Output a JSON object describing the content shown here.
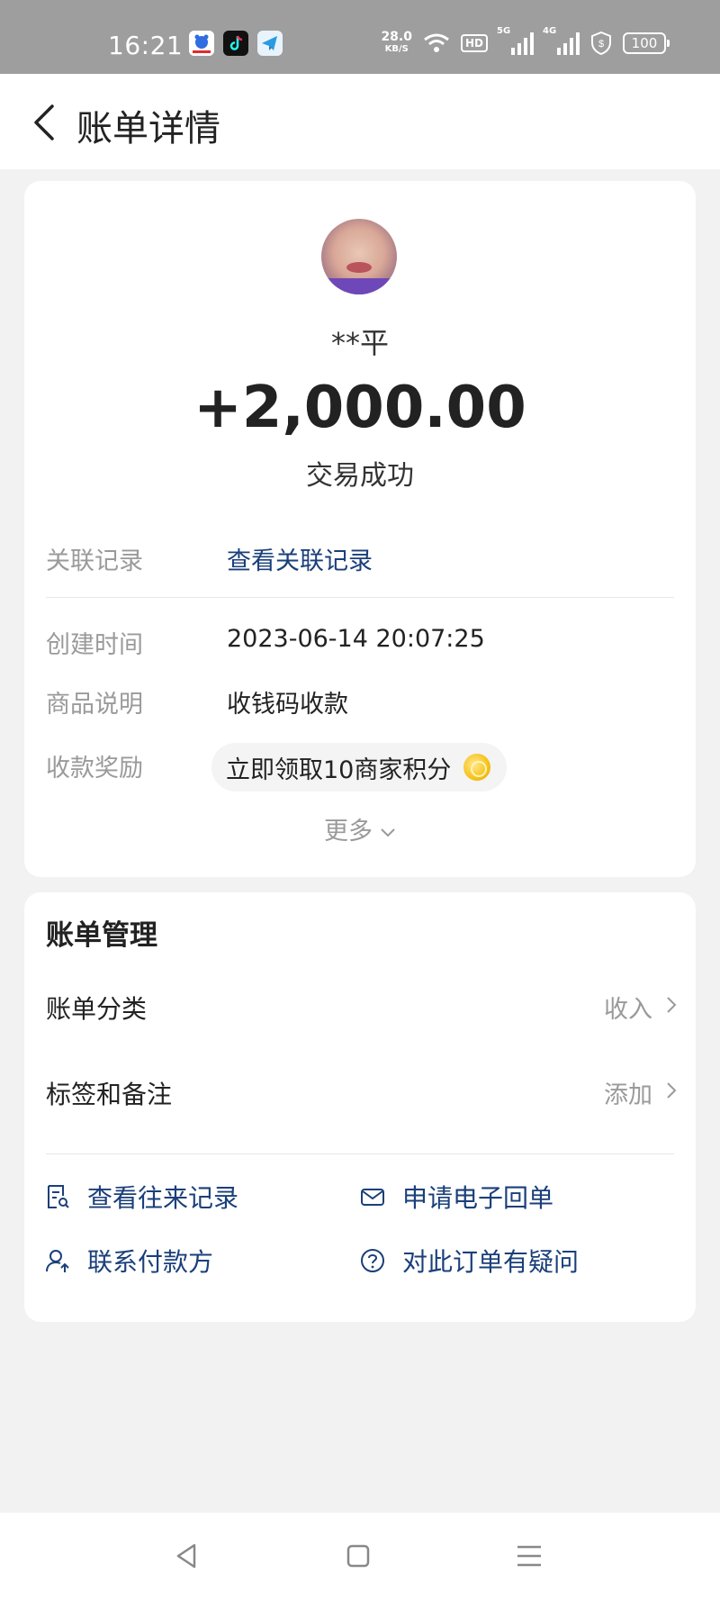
{
  "status_bar": {
    "time": "16:21",
    "net_speed": "28.0",
    "net_speed_unit": "KB/S",
    "hd": "HD",
    "signal1_tag": "5G",
    "signal2_tag": "4G",
    "battery": "100",
    "apps": [
      "baidu-app-icon",
      "tiktok-app-icon",
      "telegram-app-icon"
    ]
  },
  "header": {
    "title": "账单详情"
  },
  "transaction": {
    "payer": "**平",
    "amount": "+2,000.00",
    "status": "交易成功"
  },
  "details": {
    "related_label": "关联记录",
    "related_link": "查看关联记录",
    "created_label": "创建时间",
    "created_value": "2023-06-14 20:07:25",
    "desc_label": "商品说明",
    "desc_value": "收钱码收款",
    "reward_label": "收款奖励",
    "reward_value": "立即领取10商家积分",
    "more": "更多"
  },
  "bill_management": {
    "title": "账单管理",
    "category_label": "账单分类",
    "category_value": "收入",
    "tags_label": "标签和备注",
    "tags_value": "添加",
    "actions": {
      "history": "查看往来记录",
      "receipt": "申请电子回单",
      "contact": "联系付款方",
      "question": "对此订单有疑问"
    }
  },
  "colors": {
    "link": "#1a3f7a",
    "muted": "#9a9a9a",
    "background": "#f2f2f3",
    "status_bar": "#9e9e9e"
  }
}
